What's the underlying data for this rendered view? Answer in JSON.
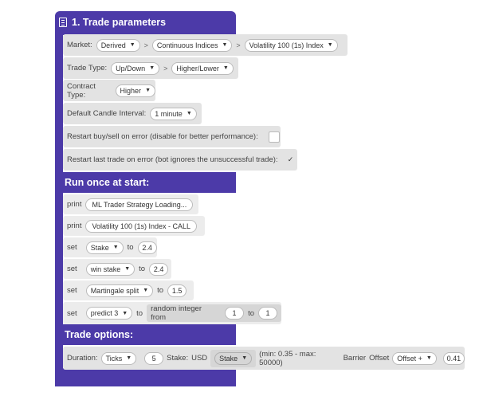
{
  "trade_parameters": {
    "title": "1. Trade parameters",
    "market_label": "Market:",
    "market_values": [
      "Derived",
      "Continuous Indices",
      "Volatility 100 (1s) Index"
    ],
    "separator": ">",
    "trade_type_label": "Trade Type:",
    "trade_type_values": [
      "Up/Down",
      "Higher/Lower"
    ],
    "contract_type_label": "Contract Type:",
    "contract_type_value": "Higher",
    "candle_interval_label": "Default Candle Interval:",
    "candle_interval_value": "1 minute",
    "restart_buysell_label": "Restart buy/sell on error (disable for better performance):",
    "restart_last_trade_label": "Restart last trade on error (bot ignores the unsuccessful trade):",
    "restart_last_trade_check": "✓"
  },
  "run_once": {
    "title": "Run once at start:",
    "print_label": "print",
    "print1_text": "ML Trader Strategy Loading...",
    "print2_text": "Volatility 100 (1s) Index - CALL",
    "set_label": "set",
    "to_label": "to",
    "set_rows": [
      {
        "var": "Stake",
        "value": "2.4"
      },
      {
        "var": "win stake",
        "value": "2.4"
      },
      {
        "var": "Martingale split",
        "value": "1.5"
      }
    ],
    "predict_var": "predict 3",
    "random_label": "random integer from",
    "random_from": "1",
    "random_to": "1"
  },
  "trade_options": {
    "title": "Trade options:",
    "duration_label": "Duration:",
    "duration_unit": "Ticks",
    "duration_value": "5",
    "stake_label": "Stake:",
    "currency": "USD",
    "stake_select": "Stake",
    "min_max": "(min: 0.35 - max: 50000)",
    "barrier_label": "Barrier",
    "offset_label": "Offset",
    "offset_select": "Offset +",
    "offset_value": "0.41"
  },
  "colors": {
    "block_purple": "#4c3aa8",
    "row_gray": "#e3e3e3"
  }
}
